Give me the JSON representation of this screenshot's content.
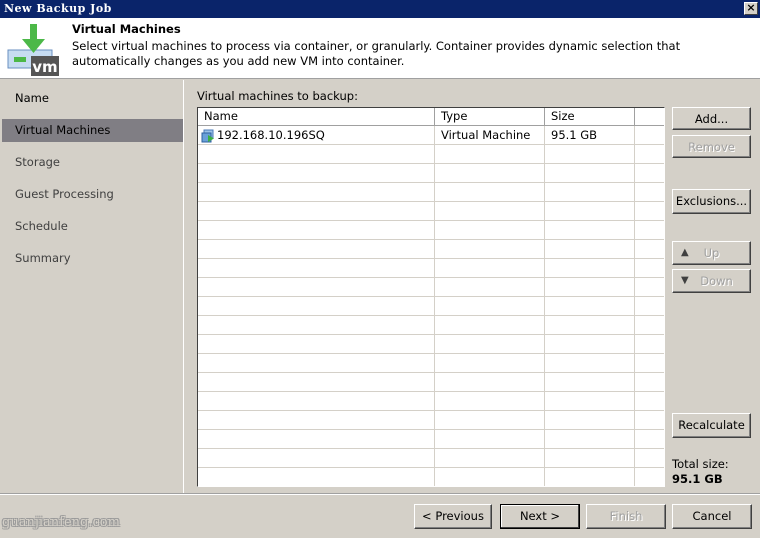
{
  "window": {
    "title": "New Backup Job",
    "close_icon": "close-icon"
  },
  "header": {
    "title": "Virtual Machines",
    "description": "Select virtual machines to process via container, or granularly. Container provides dynamic selection that automatically changes as you add new VM into container.",
    "logo_icon": "vm-download-icon",
    "logo_text": "vm"
  },
  "sidebar": {
    "items": [
      {
        "label": "Name"
      },
      {
        "label": "Virtual Machines",
        "active": true
      },
      {
        "label": "Storage"
      },
      {
        "label": "Guest Processing"
      },
      {
        "label": "Schedule"
      },
      {
        "label": "Summary"
      }
    ]
  },
  "main": {
    "list_label": "Virtual machines to backup:",
    "columns": [
      "Name",
      "Type",
      "Size"
    ],
    "rows": [
      {
        "name": "192.168.10.196SQ",
        "type": "Virtual Machine",
        "size": "95.1 GB",
        "icon": "vm-icon"
      }
    ]
  },
  "side_buttons": {
    "add": "Add...",
    "remove": "Remove",
    "exclusions": "Exclusions...",
    "up": "Up",
    "down": "Down",
    "recalculate": "Recalculate"
  },
  "total": {
    "label": "Total size:",
    "value": "95.1 GB"
  },
  "footer": {
    "previous": "< Previous",
    "next": "Next >",
    "finish": "Finish",
    "cancel": "Cancel"
  },
  "watermark": "guanjianfeng.com",
  "colors": {
    "titlebar": "#0a246a",
    "dialog_bg": "#d4d0c8",
    "active_nav": "#807e84",
    "arrow_green": "#4cb848",
    "vm_badge": "#555555"
  }
}
